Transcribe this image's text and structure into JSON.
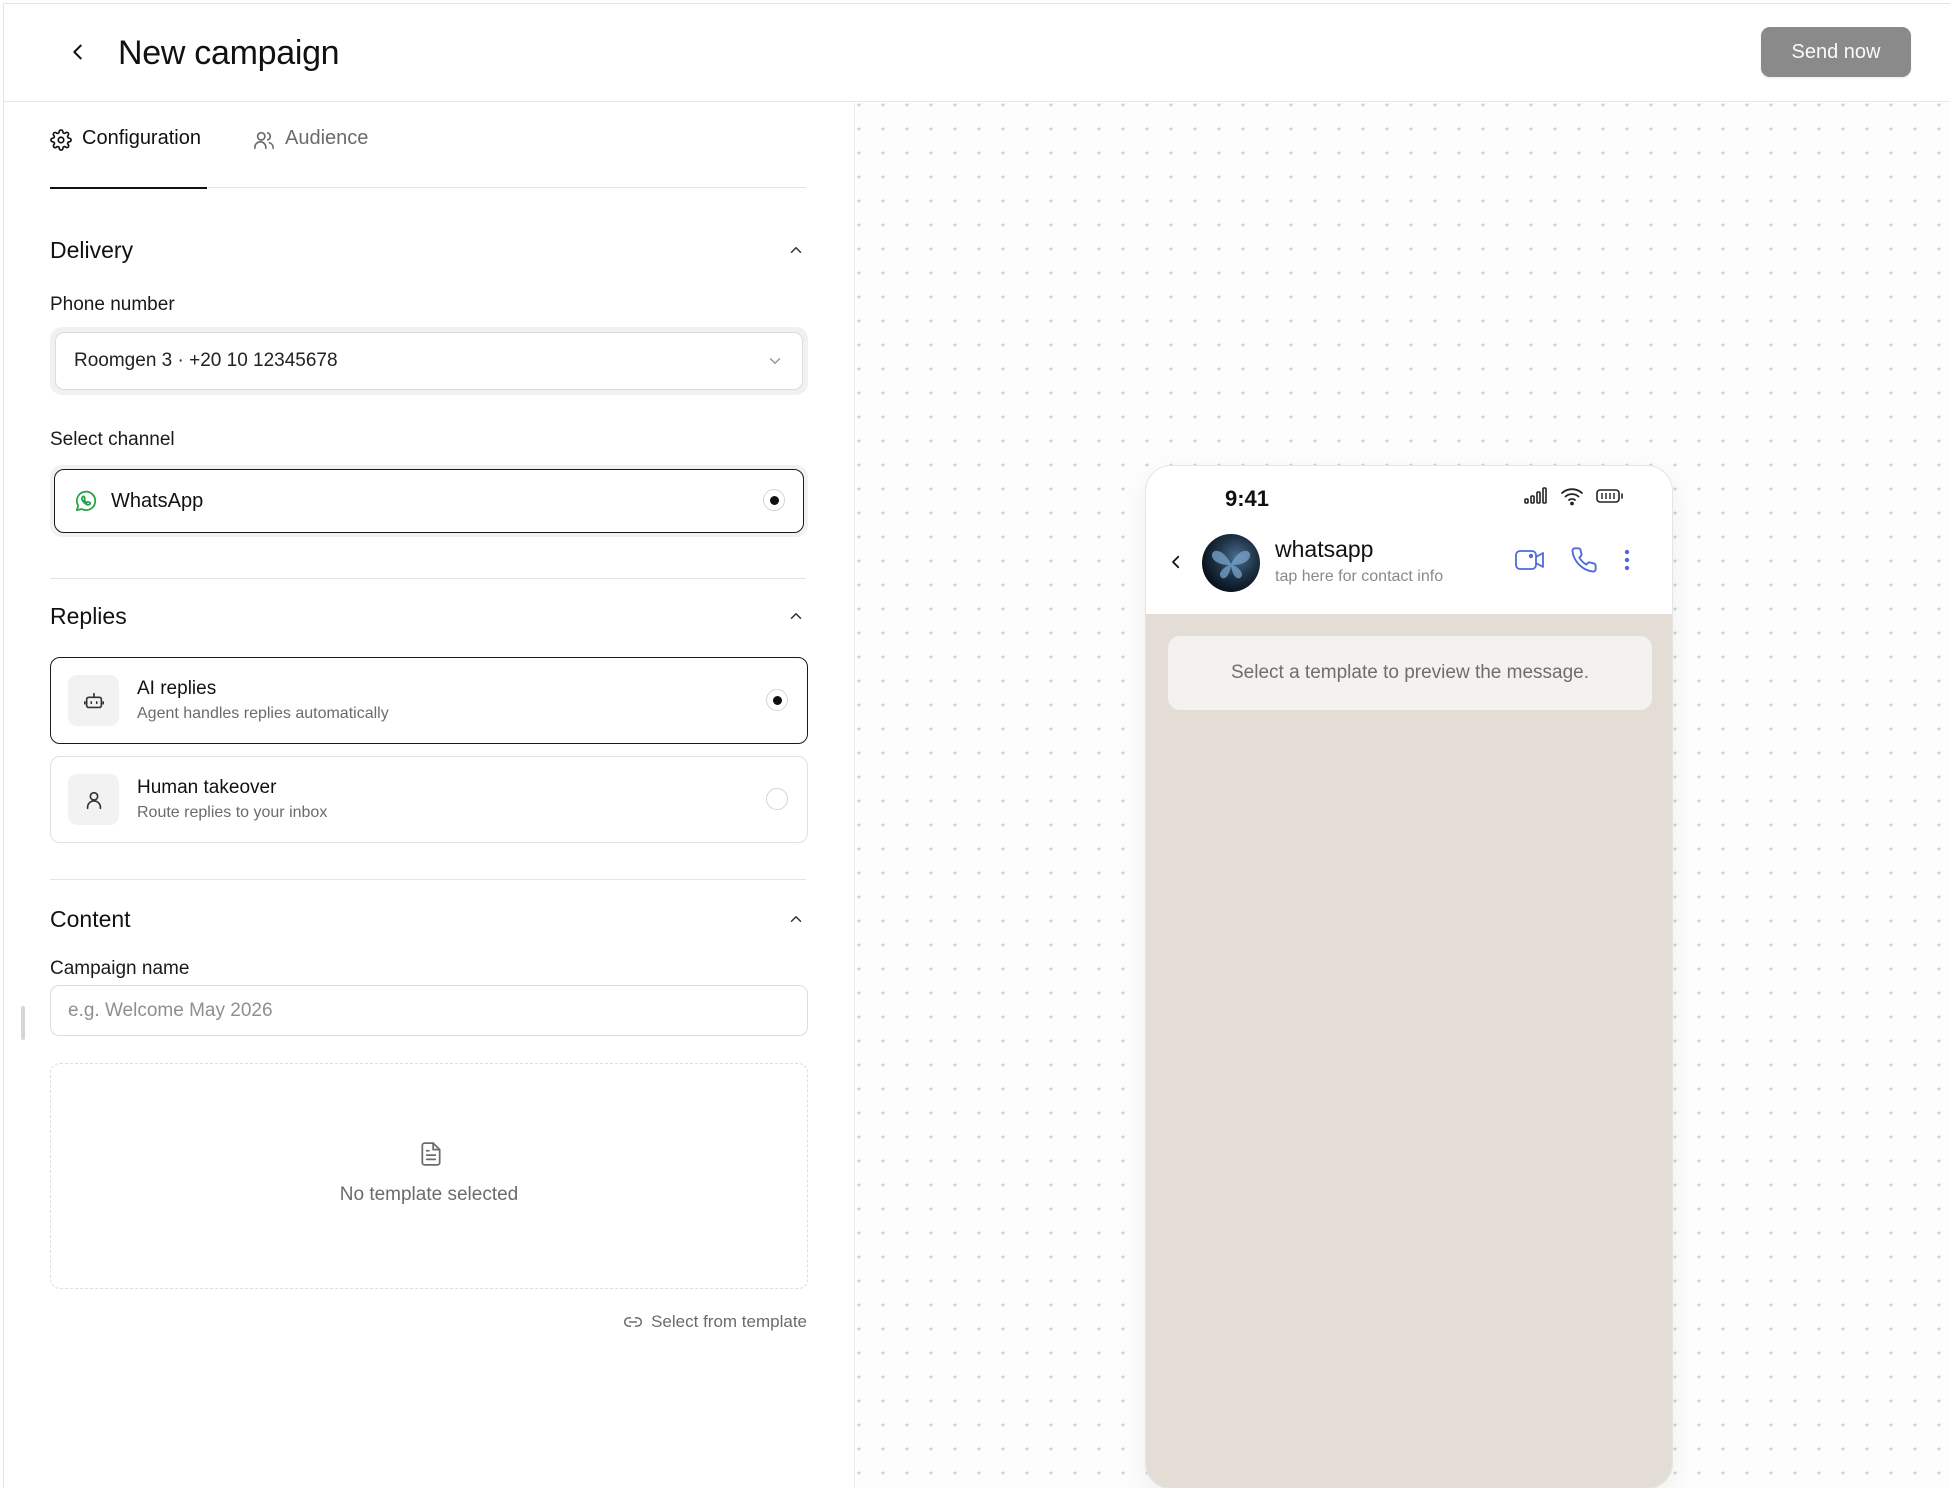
{
  "header": {
    "title": "New campaign",
    "send_label": "Send now"
  },
  "tabs": [
    {
      "label": "Configuration",
      "icon": "gear-icon",
      "active": true
    },
    {
      "label": "Audience",
      "icon": "users-icon",
      "active": false
    }
  ],
  "delivery": {
    "title": "Delivery",
    "phone_label": "Phone number",
    "phone_value": "Roomgen 3 · +20 10 12345678",
    "channel_label": "Select channel",
    "channel_value": "WhatsApp",
    "channel_icon": "whatsapp-icon"
  },
  "replies": {
    "title": "Replies",
    "options": [
      {
        "title": "AI replies",
        "subtitle": "Agent handles replies automatically",
        "icon": "bot-icon",
        "selected": true
      },
      {
        "title": "Human takeover",
        "subtitle": "Route replies to your inbox",
        "icon": "user-icon",
        "selected": false
      }
    ]
  },
  "content": {
    "title": "Content",
    "name_label": "Campaign name",
    "name_placeholder": "e.g. Welcome May 2026",
    "name_value": "",
    "empty_template": "No template selected",
    "select_template": "Select from template"
  },
  "preview": {
    "time": "9:41",
    "contact_name": "whatsapp",
    "contact_sub": "tap here for contact info",
    "message_placeholder": "Select a template to preview the message."
  },
  "colors": {
    "accent": "#111111",
    "send_button": "#8a8a8a",
    "whatsapp": "#25a244",
    "chat_background": "#e3ddd6",
    "icon_blue": "#4f6bd8"
  }
}
